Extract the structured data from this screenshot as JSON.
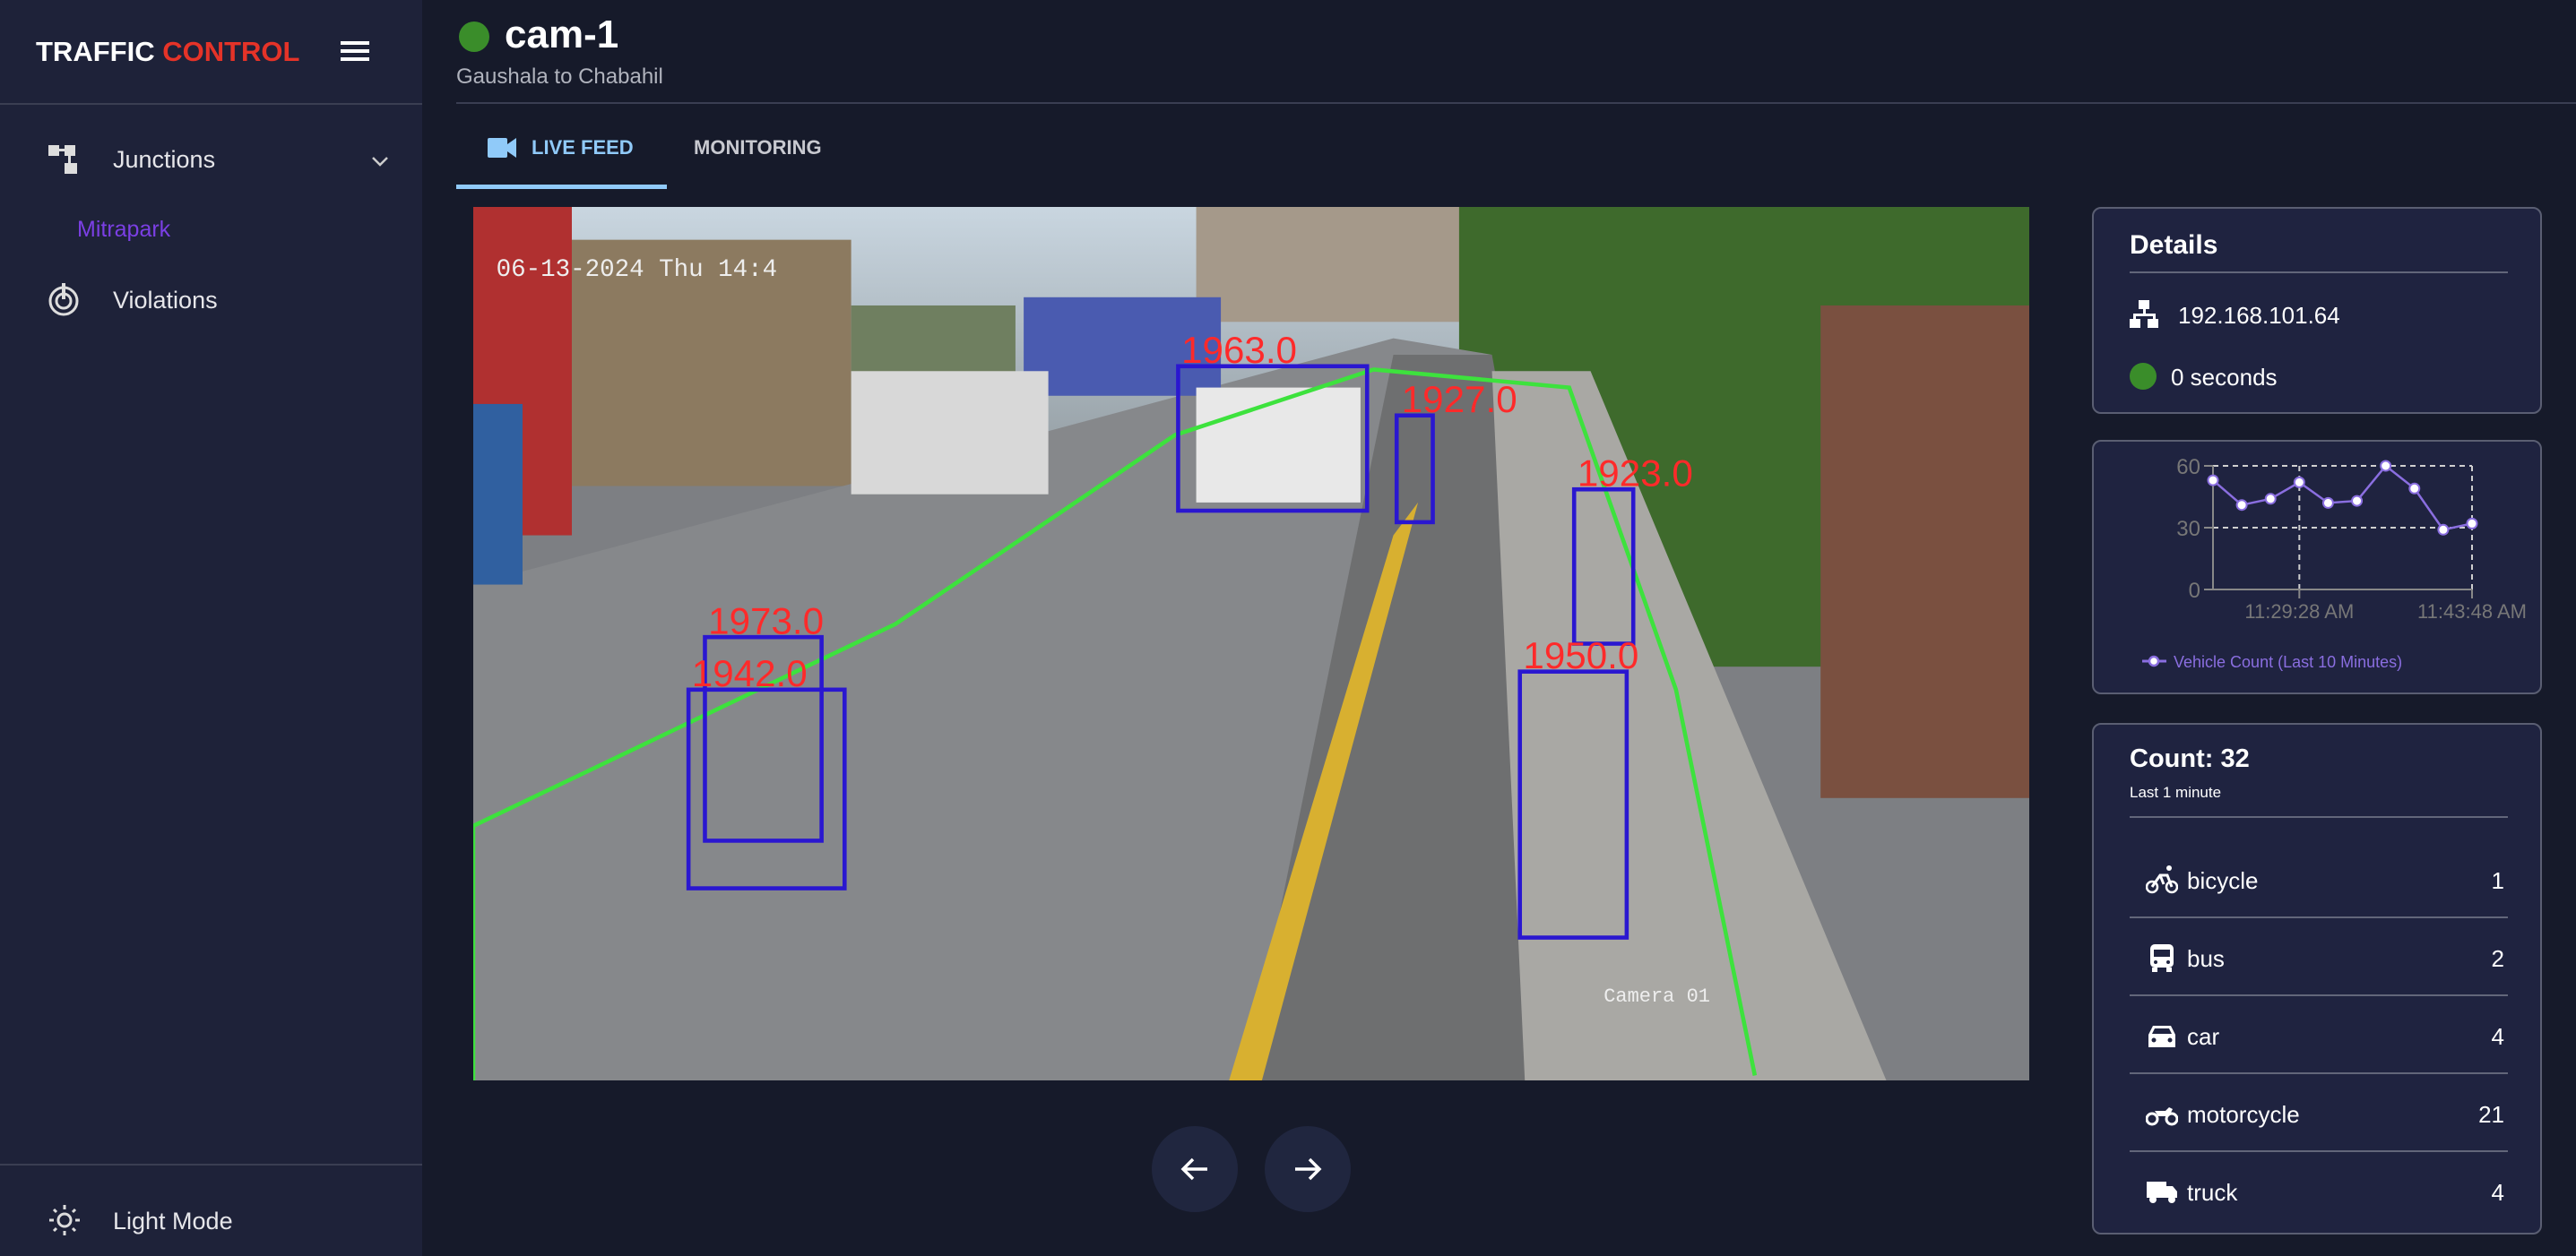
{
  "app": {
    "title_part1": "TRAFFIC",
    "title_part2": "CONTROL"
  },
  "sidebar": {
    "items": [
      {
        "label": "Junctions",
        "icon": "junctions-icon"
      },
      {
        "label": "Violations",
        "icon": "violations-icon"
      }
    ],
    "sub_items": [
      {
        "label": "Mitrapark"
      }
    ],
    "footer": {
      "label": "Light Mode",
      "icon": "sun-icon"
    }
  },
  "header": {
    "title": "cam-1",
    "subtitle": "Gaushala to Chabahil",
    "status_color": "#3a8d2a"
  },
  "tabs": [
    {
      "label": "LIVE FEED",
      "active": true
    },
    {
      "label": "MONITORING",
      "active": false
    }
  ],
  "video": {
    "overlay_timestamp": "06-13-2024 Thu 14:4",
    "overlay_camera": "Camera 01",
    "detections": [
      "1963.0",
      "1927.0",
      "1923.0",
      "1973.0",
      "1942.0",
      "1950.0"
    ]
  },
  "details": {
    "title": "Details",
    "ip": "192.168.101.64",
    "uptime": "0 seconds"
  },
  "chart_data": {
    "type": "line",
    "series": [
      {
        "name": "Vehicle Count (Last 10 Minutes)",
        "values": [
          53,
          41,
          44,
          52,
          42,
          43,
          60,
          49,
          29,
          32
        ]
      }
    ],
    "x_tick_labels": [
      {
        "index": 3,
        "label": "11:29:28 AM"
      },
      {
        "index": 9,
        "label": "11:43:48 AM"
      }
    ],
    "y_ticks": [
      "0",
      "30",
      "60"
    ],
    "ylim": [
      0,
      60
    ],
    "grid": true,
    "legend": "bottom",
    "color": "#8a6ee0"
  },
  "count": {
    "title": "Count: 32",
    "subtitle": "Last 1 minute",
    "rows": [
      {
        "label": "bicycle",
        "value": "1"
      },
      {
        "label": "bus",
        "value": "2"
      },
      {
        "label": "car",
        "value": "4"
      },
      {
        "label": "motorcycle",
        "value": "21"
      },
      {
        "label": "truck",
        "value": "4"
      }
    ]
  }
}
